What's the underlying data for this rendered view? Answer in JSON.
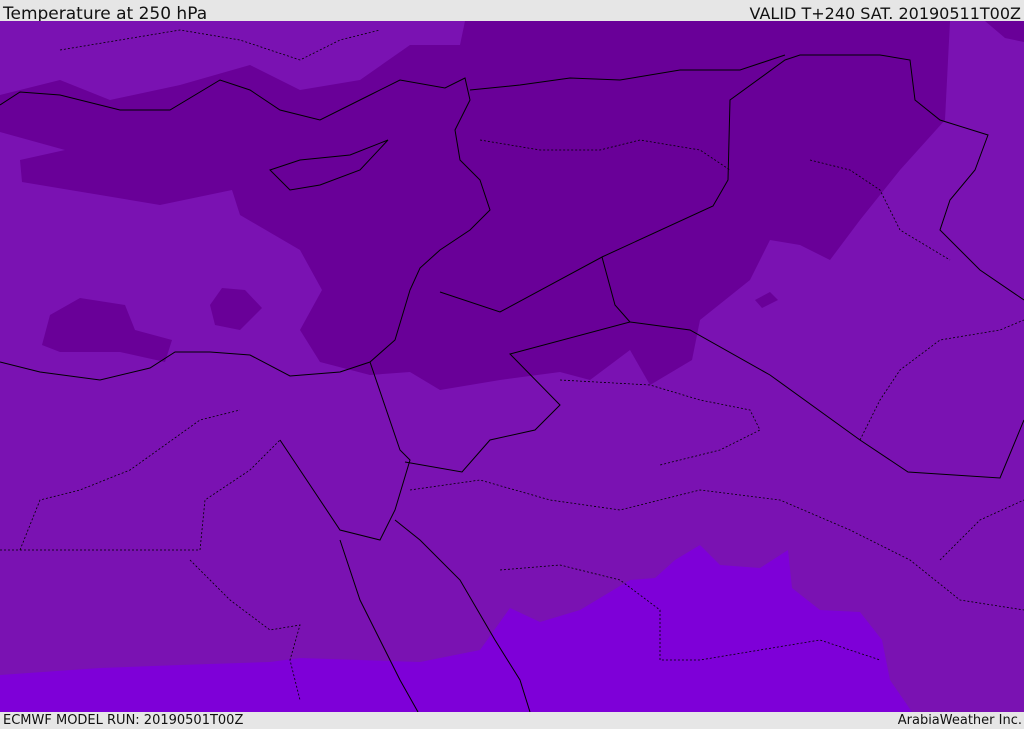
{
  "header": {
    "title": "Temperature at 250 hPa",
    "valid": "VALID T+240 SAT. 20190511T00Z"
  },
  "footer": {
    "model_run": "ECMWF MODEL RUN: 20190501T00Z",
    "brand": "ArabiaWeather Inc."
  },
  "colors": {
    "base": "#7a12b2",
    "cold": "#690098",
    "warm": "#7e00d8",
    "border": "#000000"
  }
}
